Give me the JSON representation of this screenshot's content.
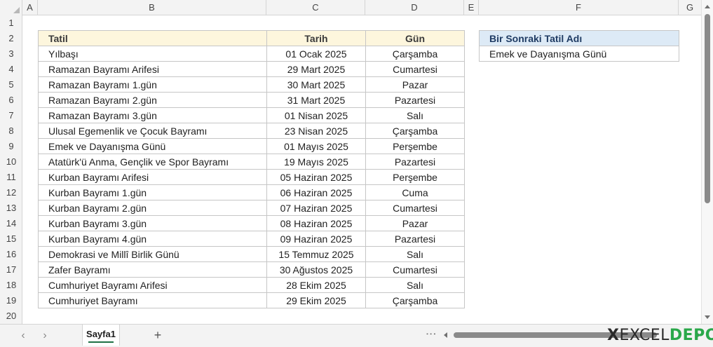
{
  "columns": [
    "A",
    "B",
    "C",
    "D",
    "E",
    "F",
    "G"
  ],
  "rows": [
    "1",
    "2",
    "3",
    "4",
    "5",
    "6",
    "7",
    "8",
    "9",
    "10",
    "11",
    "12",
    "13",
    "14",
    "15",
    "16",
    "17",
    "18",
    "19",
    "20"
  ],
  "table": {
    "headers": {
      "tatil": "Tatil",
      "tarih": "Tarih",
      "gun": "Gün"
    },
    "rows": [
      {
        "tatil": "Yılbaşı",
        "tarih": "01 Ocak 2025",
        "gun": "Çarşamba"
      },
      {
        "tatil": "Ramazan Bayramı Arifesi",
        "tarih": "29 Mart 2025",
        "gun": "Cumartesi"
      },
      {
        "tatil": "Ramazan Bayramı 1.gün",
        "tarih": "30 Mart 2025",
        "gun": "Pazar"
      },
      {
        "tatil": "Ramazan Bayramı 2.gün",
        "tarih": "31 Mart 2025",
        "gun": "Pazartesi"
      },
      {
        "tatil": "Ramazan Bayramı 3.gün",
        "tarih": "01 Nisan 2025",
        "gun": "Salı"
      },
      {
        "tatil": "Ulusal Egemenlik ve Çocuk Bayramı",
        "tarih": "23 Nisan 2025",
        "gun": "Çarşamba"
      },
      {
        "tatil": "Emek ve Dayanışma Günü",
        "tarih": "01 Mayıs 2025",
        "gun": "Perşembe"
      },
      {
        "tatil": "Atatürk'ü Anma, Gençlik ve Spor Bayramı",
        "tarih": "19 Mayıs 2025",
        "gun": "Pazartesi"
      },
      {
        "tatil": "Kurban Bayramı Arifesi",
        "tarih": "05 Haziran 2025",
        "gun": "Perşembe"
      },
      {
        "tatil": "Kurban Bayramı 1.gün",
        "tarih": "06 Haziran 2025",
        "gun": "Cuma"
      },
      {
        "tatil": "Kurban Bayramı 2.gün",
        "tarih": "07 Haziran 2025",
        "gun": "Cumartesi"
      },
      {
        "tatil": "Kurban Bayramı 3.gün",
        "tarih": "08 Haziran 2025",
        "gun": "Pazar"
      },
      {
        "tatil": "Kurban Bayramı 4.gün",
        "tarih": "09 Haziran 2025",
        "gun": "Pazartesi"
      },
      {
        "tatil": "Demokrasi ve Millî Birlik Günü",
        "tarih": "15 Temmuz 2025",
        "gun": "Salı"
      },
      {
        "tatil": "Zafer Bayramı",
        "tarih": "30 Ağustos 2025",
        "gun": "Cumartesi"
      },
      {
        "tatil": "Cumhuriyet Bayramı Arifesi",
        "tarih": "28 Ekim 2025",
        "gun": "Salı"
      },
      {
        "tatil": "Cumhuriyet Bayramı",
        "tarih": "29 Ekim 2025",
        "gun": "Çarşamba"
      }
    ]
  },
  "next_holiday": {
    "header": "Bir Sonraki Tatil Adı",
    "value": "Emek ve Dayanışma Günü"
  },
  "sheet_tabs": [
    {
      "label": "Sayfa1",
      "active": true
    }
  ],
  "add_sheet_label": "+",
  "logo": {
    "x": "X",
    "excel": "EXCEL",
    "depo": "DEPO"
  },
  "colors": {
    "table_header_bg": "#fdf6dd",
    "next_header_bg": "#ddeaf6",
    "active_tab_underline": "#1e7145",
    "logo_accent": "#2aa84a"
  }
}
